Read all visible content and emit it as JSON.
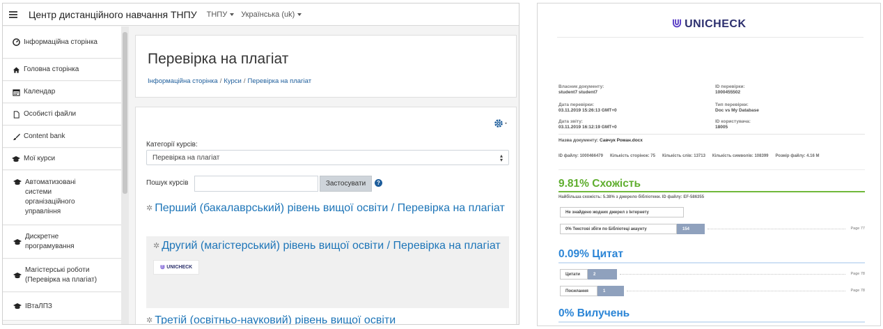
{
  "left": {
    "navbar": {
      "site_name": "Центр дистанційного навчання ТНПУ",
      "dropdown1": "ТНПУ",
      "dropdown2": "Українська (uk)"
    },
    "drawer": {
      "items": [
        {
          "label": "Інформаційна сторінка",
          "icon": "dashboard-icon"
        },
        {
          "label": "Головна сторінка",
          "icon": "home-icon"
        },
        {
          "label": "Календар",
          "icon": "calendar-icon"
        },
        {
          "label": "Особисті файли",
          "icon": "file-icon"
        },
        {
          "label": "Content bank",
          "icon": "paint-brush-icon"
        },
        {
          "label": "Мої курси",
          "icon": "graduation-cap-icon"
        },
        {
          "label": "Автоматизовані системи організаційного управління",
          "icon": "graduation-cap-icon"
        },
        {
          "label": "Дискретне програмування",
          "icon": "graduation-cap-icon"
        },
        {
          "label": "Магістерські роботи (Перевірка на плагіат)",
          "icon": "graduation-cap-icon"
        },
        {
          "label": "ІВтаЛПЗ",
          "icon": "graduation-cap-icon"
        }
      ]
    },
    "header": {
      "title": "Перевірка на плагіат",
      "breadcrumb": [
        "Інформаційна сторінка",
        "Курси",
        "Перевірка на плагіат"
      ]
    },
    "main": {
      "category_label": "Категорії курсів:",
      "category_selected": "Перевірка на плагіат",
      "search_label": "Пошук курсів",
      "search_value": "",
      "apply_label": "Застосувати",
      "help_glyph": "?",
      "categories": [
        "Перший (бакалаврський) рівень вищої освіти / Перевірка на плагіат",
        "Другий (магістерський) рівень вищої освіти / Перевірка на плагіат",
        "Третій (освітньо-науковий) рівень вищої освіти"
      ],
      "badge_text": "UNICHECK"
    }
  },
  "report": {
    "logo_text": "UNICHECK",
    "owner_label": "Власник документу:",
    "owner_value": "student7 student7",
    "check_id_label": "ID перевірки:",
    "check_id_value": "1000455502",
    "check_date_label": "Дата перевірки:",
    "check_date_value": "03.11.2019 15:26:13 GMT+0",
    "check_type_label": "Тип перевірки:",
    "check_type_value": "Doc vs My Database",
    "report_date_label": "Дата звіту:",
    "report_date_value": "03.11.2019 16:12:19 GMT+0",
    "user_id_label": "ID користувача:",
    "user_id_value": "18005",
    "doc_name_label": "Назва документу:",
    "doc_name_value": "Савчук Роман.docx",
    "file_meta": [
      "ID файлу: 1000466479",
      "Кількість сторінок: 75",
      "Кількість слів: 13713",
      "Кількість символів: 108399",
      "Розмір файлу: 4.16 M"
    ],
    "similarity_title": "9.81% Схожість",
    "highest_similarity": "Найбільша схожість: 5.38% з джерело бібліотеки. ID файлу: EF-586355",
    "no_internet": "Не знайдено жодних джерел з Інтернету",
    "library_bar": {
      "label": "0% Текстові збіги по Бібліотеці акаунту",
      "count": "154",
      "page": "Page 77"
    },
    "citations_title": "0.09% Цитат",
    "citations_bar": {
      "label": "Цитати",
      "count": "2",
      "page": "Page 78"
    },
    "references_bar": {
      "label": "Посилання",
      "count": "1",
      "page": "Page 78"
    },
    "exclusions_title": "0% Вилучень"
  }
}
